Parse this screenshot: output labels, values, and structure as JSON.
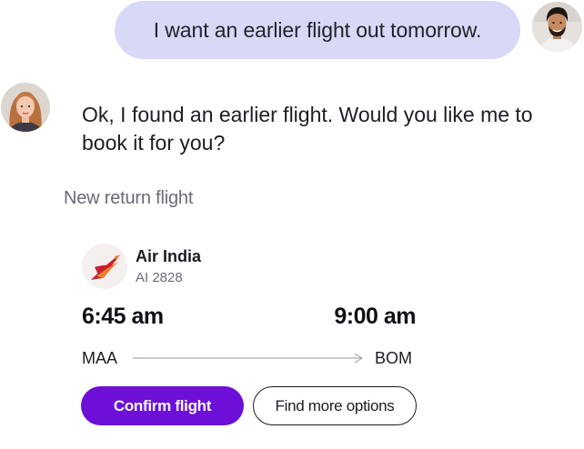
{
  "conversation": {
    "user_message": "I want an earlier flight out tomorrow.",
    "agent_message": "Ok, I found an earlier flight. Would you like me to book it for you?"
  },
  "flight_card": {
    "section_label": "New return flight",
    "airline_name": "Air India",
    "flight_number": "AI 2828",
    "departure_time": "6:45 am",
    "arrival_time": "9:00 am",
    "origin": "MAA",
    "destination": "BOM",
    "logo_icon": "air-india-logo",
    "confirm_label": "Confirm flight",
    "more_options_label": "Find more options"
  },
  "colors": {
    "user_bubble": "#d7d9f7",
    "primary_button": "#6d0fd7",
    "label_gray": "#6b6a78",
    "airline_red": "#c8202f",
    "airline_orange": "#e8832a"
  }
}
